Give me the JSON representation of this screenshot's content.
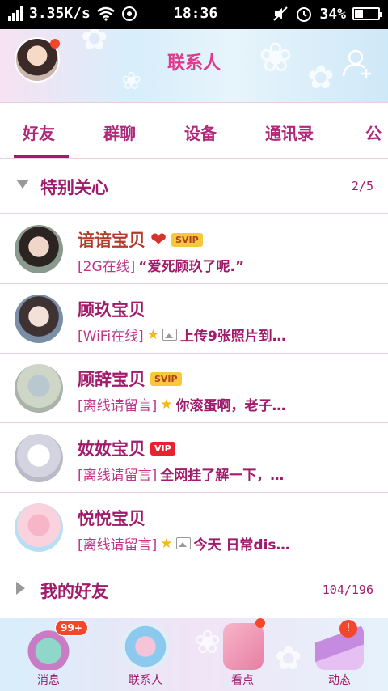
{
  "status_bar": {
    "speed": "3.35K/s",
    "time": "18:36",
    "battery": "34%",
    "battery_level": 0.34
  },
  "header": {
    "title": "联系人",
    "avatar_icon": "profile-avatar",
    "add_icon": "add-contact-icon"
  },
  "tabs": [
    {
      "label": "好友",
      "active": true
    },
    {
      "label": "群聊"
    },
    {
      "label": "设备"
    },
    {
      "label": "通讯录"
    },
    {
      "label": "公"
    }
  ],
  "special_section": {
    "label": "特别关心",
    "count": "2/5"
  },
  "contacts": [
    {
      "name": "谙谙宝贝",
      "badge": "SVIP",
      "heart": "❤",
      "status": "[2G在线]",
      "message": "“爱死顾玖了呢.”"
    },
    {
      "name": "顾玖宝贝",
      "status": "[WiFi在线]",
      "star": "★",
      "message": "上传9张照片到…"
    },
    {
      "name": "顾辞宝贝",
      "badge": "SVIP",
      "status": "[离线请留言]",
      "star": "★",
      "message": "你滚蛋啊，老子…"
    },
    {
      "name": "奻奻宝贝",
      "badge": "VIP",
      "status": "[离线请留言]",
      "message": "全网挂了解一下，…"
    },
    {
      "name": "悦悦宝贝",
      "status": "[离线请留言]",
      "star": "★",
      "message": "今天 日常dis…"
    }
  ],
  "friends_section": {
    "label": "我的好友",
    "count": "104/196"
  },
  "bottom_nav": [
    {
      "label": "消息",
      "badge": "99+"
    },
    {
      "label": "联系人"
    },
    {
      "label": "看点"
    },
    {
      "label": "动态",
      "badge": "!"
    }
  ],
  "colors": {
    "accent": "#a01b6b",
    "title_pink": "#e03a8e",
    "badge_red": "#f2472b",
    "svip_gold": "#f7c73c",
    "vip_red": "#e8222f"
  }
}
